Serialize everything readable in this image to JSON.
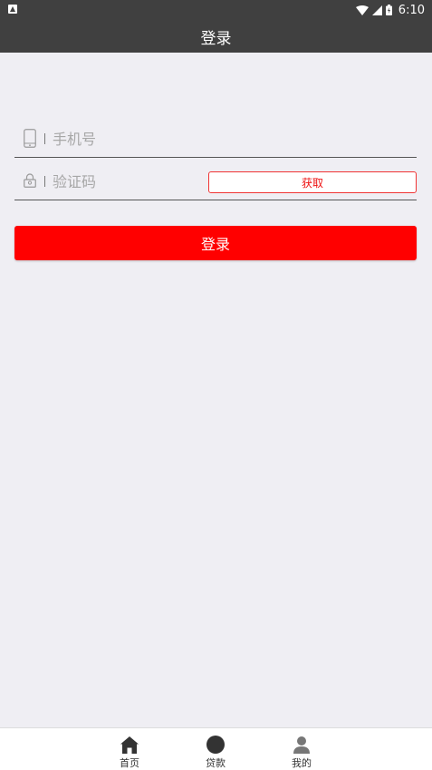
{
  "status_bar": {
    "time": "6:10"
  },
  "header": {
    "title": "登录"
  },
  "form": {
    "phone_placeholder": "手机号",
    "code_placeholder": "验证码",
    "get_code_label": "获取",
    "login_label": "登录"
  },
  "bottom_nav": {
    "items": [
      {
        "label": "首页",
        "icon": "home-icon"
      },
      {
        "label": "贷款",
        "icon": "circle-icon"
      },
      {
        "label": "我的",
        "icon": "person-icon"
      }
    ]
  },
  "colors": {
    "header_bg": "#404040",
    "page_bg": "#efeef3",
    "accent": "#ff0000"
  }
}
